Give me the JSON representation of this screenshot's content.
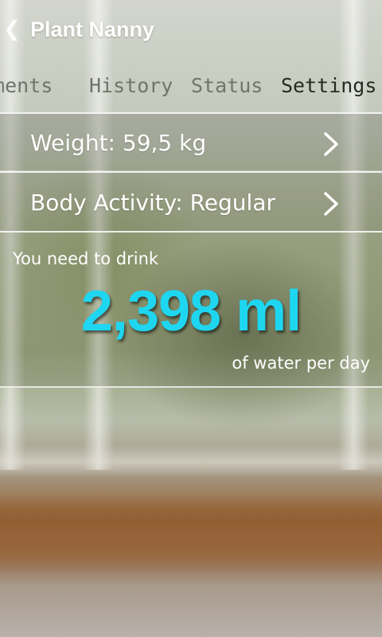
{
  "app": {
    "title": "Plant Nanny",
    "back_icon": "chevron-left-icon"
  },
  "tabs": [
    {
      "label": "Achievements",
      "visible_label": "ements",
      "active": false
    },
    {
      "label": "History",
      "active": false
    },
    {
      "label": "Status",
      "active": false
    },
    {
      "label": "Settings",
      "active": true
    }
  ],
  "settings": {
    "weight_label": "Weight: 59,5 kg",
    "activity_label": "Body Activity: Regular",
    "row_icon": "chevron-right-icon"
  },
  "result": {
    "intro": "You need to drink",
    "amount": "2,398 ml",
    "suffix": "of water per day"
  },
  "colors": {
    "accent": "#1fd6f0",
    "text": "#ffffff",
    "tab_active": "#262a22",
    "tab_inactive": "#6f756a"
  }
}
